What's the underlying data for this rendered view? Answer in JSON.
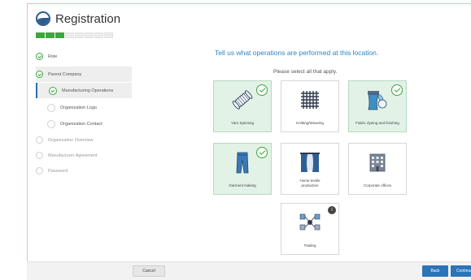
{
  "app": {
    "title": "Registration"
  },
  "progress": {
    "completed_segments": 3,
    "total_segments": 8
  },
  "sidebar": {
    "steps": [
      {
        "label": "Role",
        "state": "done"
      },
      {
        "label": "Parent Company",
        "state": "done"
      },
      {
        "label": "Manufacturing Operations",
        "state": "current"
      },
      {
        "label": "Organization Logo",
        "state": "todo"
      },
      {
        "label": "Organization Contact",
        "state": "todo"
      },
      {
        "label": "Organization Overview",
        "state": "todo"
      },
      {
        "label": "Manufacturer Agreement",
        "state": "todo"
      },
      {
        "label": "Password",
        "state": "todo"
      }
    ]
  },
  "main": {
    "question": "Tell us what operations are performed at this location.",
    "instruction": "Please select all that apply.",
    "options": [
      {
        "label": "Yarn Spinning",
        "selected": true,
        "icon": "yarn-spool-icon"
      },
      {
        "label": "Knitting/Weaving",
        "selected": false,
        "icon": "knit-fabric-icon"
      },
      {
        "label": "Fabric dyeing and finishing",
        "selected": true,
        "icon": "fabric-dyeing-icon"
      },
      {
        "label": "Garment making",
        "selected": true,
        "icon": "jeans-icon"
      },
      {
        "label": "Home textile production",
        "selected": false,
        "icon": "curtains-icon"
      },
      {
        "label": "Corporate offices",
        "selected": false,
        "icon": "office-building-icon"
      },
      {
        "label": "Trading",
        "selected": false,
        "icon": "trading-network-icon",
        "info_badge": "i"
      }
    ]
  },
  "footer": {
    "cancel_label": "Cancel",
    "back_label": "Back",
    "continue_label": "Continue"
  },
  "colors": {
    "accent_blue": "#2b74b8",
    "success_green": "#3ea63e",
    "selected_card_bg": "#e2f2e6",
    "question_text": "#2a86c4"
  }
}
